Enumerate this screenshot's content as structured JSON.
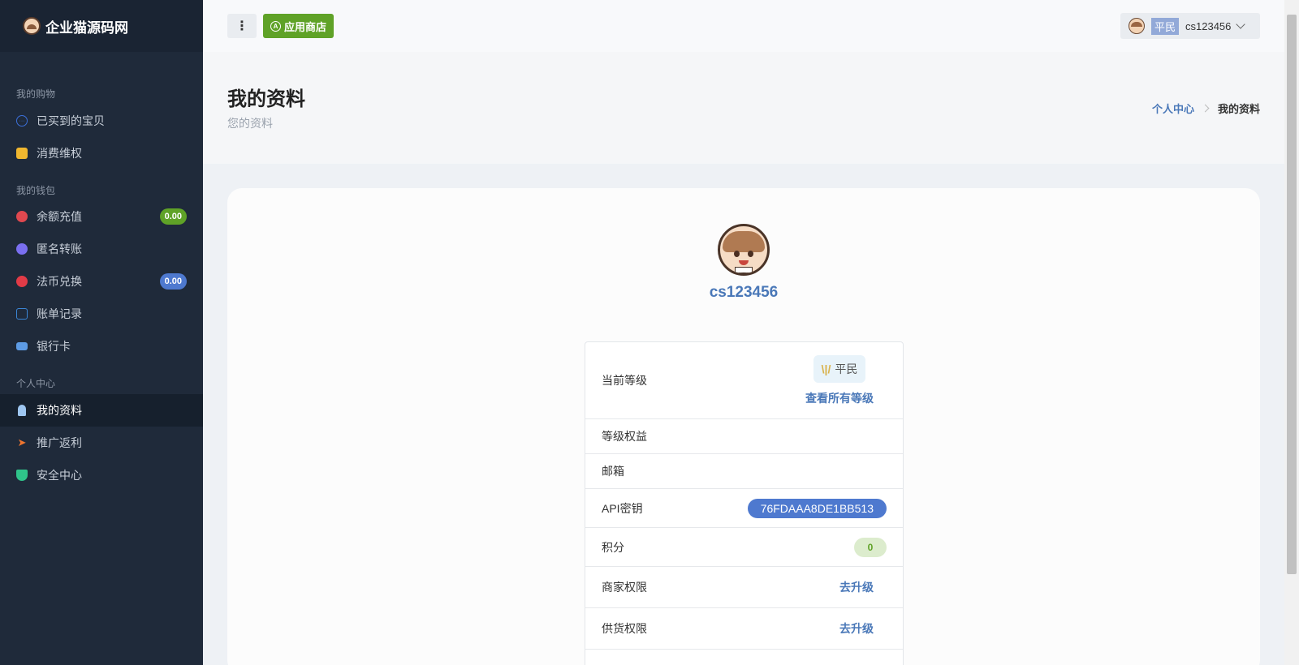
{
  "brand": {
    "name": "企业猫源码网"
  },
  "sidebar": {
    "sections": [
      {
        "title": "我的购物",
        "items": [
          {
            "label": "已买到的宝贝",
            "icon": "circle-dots-icon"
          },
          {
            "label": "消费维权",
            "icon": "receipt-icon"
          }
        ]
      },
      {
        "title": "我的钱包",
        "items": [
          {
            "label": "余额充值",
            "icon": "balance-icon",
            "badge": "0.00"
          },
          {
            "label": "匿名转账",
            "icon": "transfer-icon"
          },
          {
            "label": "法币兑换",
            "icon": "exchange-icon",
            "badge": "0.00"
          },
          {
            "label": "账单记录",
            "icon": "bill-icon"
          },
          {
            "label": "银行卡",
            "icon": "bank-card-icon"
          }
        ]
      },
      {
        "title": "个人中心",
        "items": [
          {
            "label": "我的资料",
            "icon": "user-icon",
            "active": true
          },
          {
            "label": "推广返利",
            "icon": "paper-plane-icon"
          },
          {
            "label": "安全中心",
            "icon": "shield-icon"
          }
        ]
      }
    ]
  },
  "header": {
    "menu_label": "⋮",
    "store_label": "应用商店",
    "user": {
      "rank": "平民",
      "name": "cs123456"
    }
  },
  "page": {
    "title": "我的资料",
    "subtitle": "您的资料",
    "breadcrumb": {
      "parent": "个人中心",
      "current": "我的资料"
    }
  },
  "profile": {
    "username": "cs123456",
    "rows": {
      "level_label": "当前等级",
      "level_value": "平民",
      "level_link": "查看所有等级",
      "rights_label": "等级权益",
      "email_label": "邮箱",
      "api_label": "API密钥",
      "api_value": "76FDAAA8DE1BB513",
      "points_label": "积分",
      "points_value": "0",
      "merchant_label": "商家权限",
      "merchant_link": "去升级",
      "supply_label": "供货权限",
      "supply_link": "去升级"
    }
  },
  "colors": {
    "sidebar_bg": "#1f2a3a",
    "accent_green": "#5fa227",
    "accent_blue": "#4e79cf",
    "link_blue": "#4a78b8"
  }
}
